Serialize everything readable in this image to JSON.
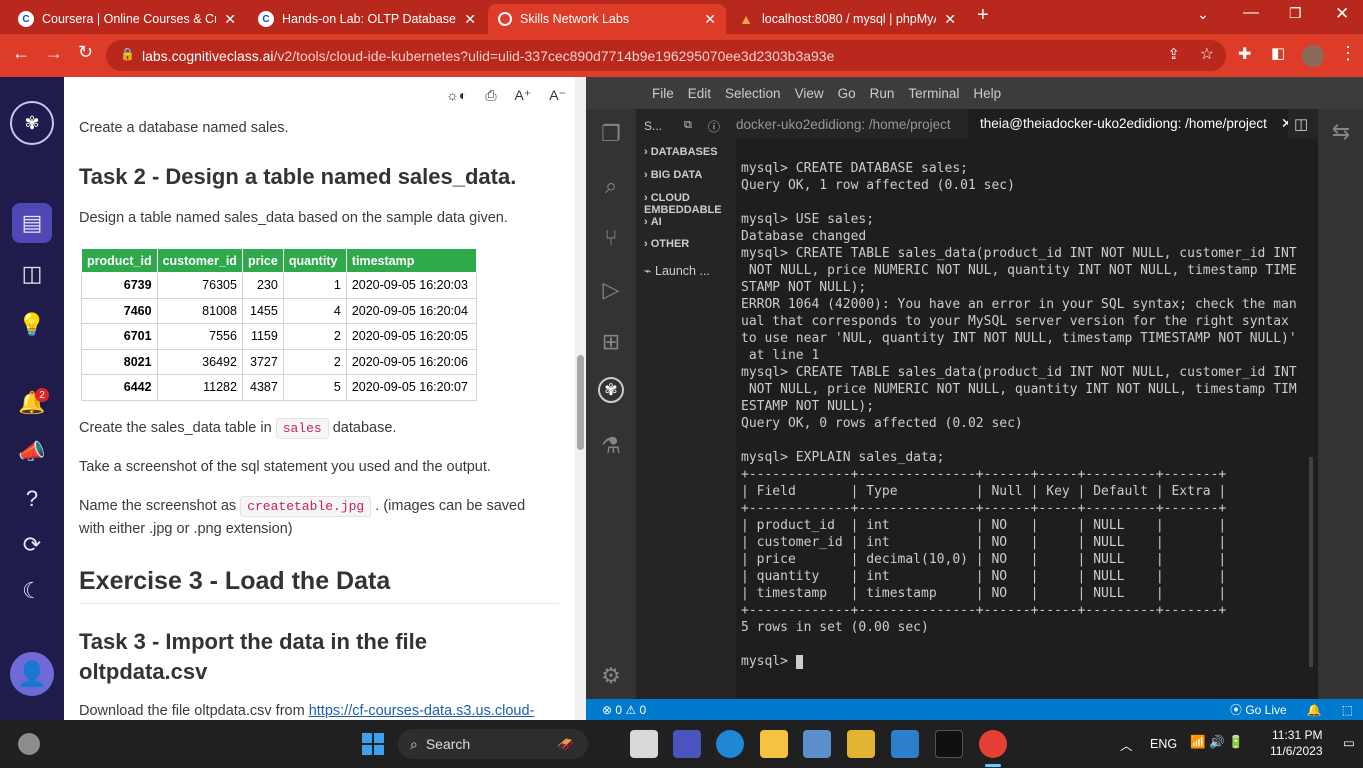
{
  "browser": {
    "tabs": [
      {
        "title": "Coursera | Online Courses & Cre",
        "icon": "coursera-icon"
      },
      {
        "title": "Hands-on Lab: OLTP Database | C",
        "icon": "coursera-icon"
      },
      {
        "title": "Skills Network Labs",
        "icon": "skills-network-icon",
        "active": true
      },
      {
        "title": "localhost:8080 / mysql | phpMyA",
        "icon": "phpmyadmin-icon"
      }
    ],
    "new_tab": "+",
    "url_host": "labs.cognitiveclass.ai",
    "url_path": "/v2/tools/cloud-ide-kubernetes?ulid=ulid-337cec890d7714b9e196295070ee3d2303b3a93e"
  },
  "left_rail": {
    "notification_badge": "2"
  },
  "doc": {
    "toolbar": {
      "font_increase": "A⁺",
      "font_decrease": "A⁻"
    },
    "intro": "Create a database named sales.",
    "task2_heading": "Task 2 - Design a table named sales_data.",
    "task2_text": "Design a table named sales_data based on the sample data given.",
    "table": {
      "headers": [
        "product_id",
        "customer_id",
        "price",
        "quantity",
        "timestamp"
      ],
      "rows": [
        [
          "6739",
          "76305",
          "230",
          "1",
          "2020-09-05 16:20:03"
        ],
        [
          "7460",
          "81008",
          "1455",
          "4",
          "2020-09-05 16:20:04"
        ],
        [
          "6701",
          "7556",
          "1159",
          "2",
          "2020-09-05 16:20:05"
        ],
        [
          "8021",
          "36492",
          "3727",
          "2",
          "2020-09-05 16:20:06"
        ],
        [
          "6442",
          "11282",
          "4387",
          "5",
          "2020-09-05 16:20:07"
        ]
      ]
    },
    "create_pre": "Create the sales_data table in",
    "create_code": "sales",
    "create_post": "database.",
    "screenshot_text": "Take a screenshot of the sql statement you used and the output.",
    "name_pre": "Name the screenshot as",
    "name_code": "createtable.jpg",
    "name_post": ". (images can be saved",
    "name_line2": "with either .jpg or .png extension)",
    "exercise3_heading": "Exercise 3 - Load the Data",
    "task3_heading_line1": "Task 3 - Import the data in the file",
    "task3_heading_line2": "oltpdata.csv",
    "download_pre": "Download the file oltpdata.csv from",
    "download_link": "https://cf-courses-data.s3.us.cloud-"
  },
  "ide": {
    "menu": [
      "File",
      "Edit",
      "Selection",
      "View",
      "Go",
      "Run",
      "Terminal",
      "Help"
    ],
    "sidebar_title": "S...",
    "sidebar_items": [
      "DATABASES",
      "BIG DATA",
      "CLOUD",
      "EMBEDDABLE",
      "AI",
      "OTHER"
    ],
    "launch_label": "Launch ...",
    "terminal_tab_inactive": "docker-uko2edidiong: /home/project",
    "terminal_tab_active": "theia@theiadocker-uko2edidiong: /home/project",
    "terminal_lines": [
      "mysql> CREATE DATABASE sales;",
      "Query OK, 1 row affected (0.01 sec)",
      "",
      "mysql> USE sales;",
      "Database changed",
      "mysql> CREATE TABLE sales_data(product_id INT NOT NULL, customer_id INT",
      " NOT NULL, price NUMERIC NOT NUL, quantity INT NOT NULL, timestamp TIME",
      "STAMP NOT NULL);",
      "ERROR 1064 (42000): You have an error in your SQL syntax; check the man",
      "ual that corresponds to your MySQL server version for the right syntax",
      "to use near 'NUL, quantity INT NOT NULL, timestamp TIMESTAMP NOT NULL)'",
      " at line 1",
      "mysql> CREATE TABLE sales_data(product_id INT NOT NULL, customer_id INT",
      " NOT NULL, price NUMERIC NOT NULL, quantity INT NOT NULL, timestamp TIM",
      "ESTAMP NOT NULL);",
      "Query OK, 0 rows affected (0.02 sec)",
      "",
      "mysql> EXPLAIN sales_data;",
      "+-------------+---------------+------+-----+---------+-------+",
      "| Field       | Type          | Null | Key | Default | Extra |",
      "+-------------+---------------+------+-----+---------+-------+",
      "| product_id  | int           | NO   |     | NULL    |       |",
      "| customer_id | int           | NO   |     | NULL    |       |",
      "| price       | decimal(10,0) | NO   |     | NULL    |       |",
      "| quantity    | int           | NO   |     | NULL    |       |",
      "| timestamp   | timestamp     | NO   |     | NULL    |       |",
      "+-------------+---------------+------+-----+---------+-------+",
      "5 rows in set (0.00 sec)",
      ""
    ],
    "prompt": "mysql> ",
    "status_errors": "0",
    "status_warnings": "0",
    "go_live": "Go Live"
  },
  "taskbar": {
    "search_label": "Search",
    "language": "ENG",
    "time": "11:31 PM",
    "date": "11/6/2023"
  }
}
